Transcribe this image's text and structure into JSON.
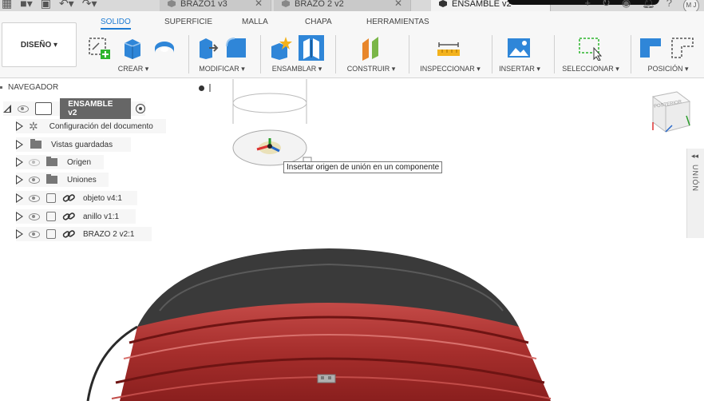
{
  "tabs": [
    {
      "label": "BRAZO1 v3",
      "active": false
    },
    {
      "label": "BRAZO 2 v2",
      "active": false
    },
    {
      "label": "ENSAMBLE v2",
      "active": true
    }
  ],
  "user": {
    "initials": "M J"
  },
  "toolbar": {
    "workspace_button": "DISEÑO ▾",
    "category_tabs": [
      "SOLIDO",
      "SUPERFICIE",
      "MALLA",
      "CHAPA",
      "HERRAMIENTAS"
    ],
    "groups": [
      "CREAR ▾",
      "MODIFICAR ▾",
      "ENSAMBLAR ▾",
      "CONSTRUIR ▾",
      "INSPECCIONAR ▾",
      "INSERTAR ▾",
      "SELECCIONAR ▾",
      "POSICIÓN ▾"
    ]
  },
  "navigator": {
    "title": "NAVEGADOR",
    "root": "ENSAMBLE v2",
    "items": [
      {
        "label": "Configuración del documento",
        "type": "settings"
      },
      {
        "label": "Vistas guardadas",
        "type": "folder"
      },
      {
        "label": "Origen",
        "type": "folder"
      },
      {
        "label": "Uniones",
        "type": "folder"
      },
      {
        "label": "objeto v4:1",
        "type": "component"
      },
      {
        "label": "anillo v1:1",
        "type": "component"
      },
      {
        "label": "BRAZO 2 v2:1",
        "type": "component"
      }
    ]
  },
  "viewport": {
    "tooltip": "Insertar origen de unión en un componente",
    "side_panel_label": "UNIÓN",
    "side_panel_arrows": "◂◂",
    "viewcube_label": "POSTERIOR"
  },
  "colors": {
    "accent": "#1d7bd3",
    "part_red": "#a8302f",
    "part_dark": "#3a3a3a"
  }
}
